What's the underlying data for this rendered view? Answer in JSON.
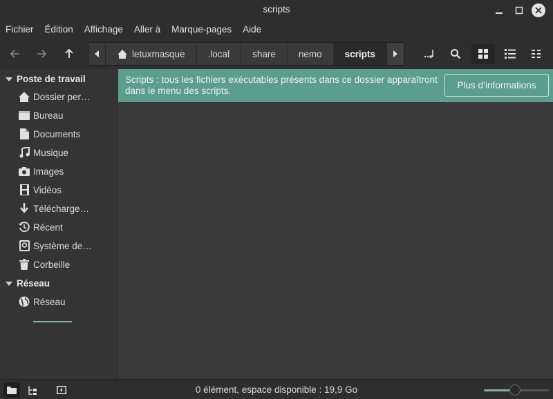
{
  "window": {
    "title": "scripts"
  },
  "menubar": {
    "items": [
      "Fichier",
      "Édition",
      "Affichage",
      "Aller à",
      "Marque-pages",
      "Aide"
    ]
  },
  "toolbar": {
    "back_icon": "arrow-left-icon",
    "forward_icon": "arrow-right-icon",
    "up_icon": "arrow-up-icon",
    "breadcrumb": [
      "letuxmasque",
      ".local",
      "share",
      "nemo",
      "scripts"
    ],
    "active_crumb": "scripts"
  },
  "sidebar": {
    "sections": [
      {
        "title": "Poste de travail"
      },
      {
        "title": "Réseau"
      }
    ],
    "items": [
      {
        "label": "Dossier per…",
        "icon": "home-icon"
      },
      {
        "label": "Bureau",
        "icon": "desktop-icon"
      },
      {
        "label": "Documents",
        "icon": "document-icon"
      },
      {
        "label": "Musique",
        "icon": "music-icon"
      },
      {
        "label": "Images",
        "icon": "camera-icon"
      },
      {
        "label": "Vidéos",
        "icon": "film-icon"
      },
      {
        "label": "Télécharge…",
        "icon": "download-icon"
      },
      {
        "label": "Récent",
        "icon": "history-icon"
      },
      {
        "label": "Système de…",
        "icon": "drive-icon"
      },
      {
        "label": "Corbeille",
        "icon": "trash-icon"
      },
      {
        "label": "Réseau",
        "icon": "network-icon"
      }
    ]
  },
  "infobar": {
    "text": "Scripts : tous les fichiers exécutables présents dans ce dossier apparaîtront dans le menu des scripts.",
    "button": "Plus d’informations"
  },
  "statusbar": {
    "text": "0 élément, espace disponible : 19,9 Go",
    "zoom_level": 0.48
  },
  "colors": {
    "accent": "#5b9e8e",
    "background": "#383838"
  }
}
